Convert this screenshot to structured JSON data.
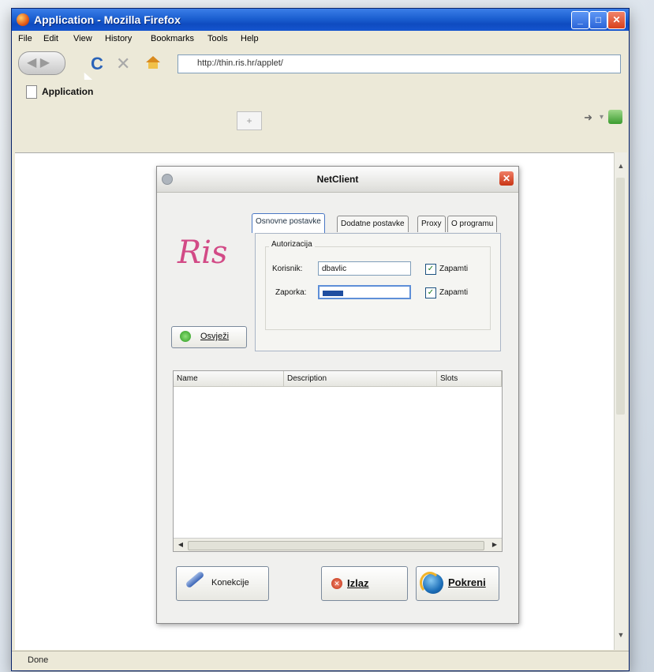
{
  "browser": {
    "window_title": "Application - Mozilla Firefox",
    "menu": [
      "File",
      "Edit",
      "View",
      "History",
      "Bookmarks",
      "Tools",
      "Help"
    ],
    "url": "http://thin.ris.hr/applet/",
    "tab_label": "Application",
    "new_tab_glyph": "+",
    "status": "Done",
    "icons": [
      "firefox-logo-icon",
      "back-icon",
      "forward-icon",
      "reload-icon",
      "stop-icon",
      "home-icon",
      "page-icon",
      "go-arrow-icon",
      "extension-icon"
    ]
  },
  "dialog": {
    "title": "NetClient",
    "logo_text": "Ris",
    "tabs": [
      "Osnovne postavke",
      "Dodatne postavke",
      "Proxy",
      "O programu"
    ],
    "active_tab": "Osnovne postavke",
    "group_title": "Autorizacija",
    "username_label": "Korisnik:",
    "username_value": "dbavlic",
    "password_label": "Zaporka:",
    "remember_label_1": "Zapamti",
    "remember_label_2": "Zapamti",
    "remember_user_checked": true,
    "remember_pass_checked": true,
    "refresh_button": "Osvježi",
    "table": {
      "columns": [
        "Name",
        "Description",
        "Slots"
      ],
      "rows": []
    },
    "buttons": {
      "konekcije": "Konekcije",
      "izlaz": "Izlaz",
      "pokreni": "Pokreni"
    }
  }
}
